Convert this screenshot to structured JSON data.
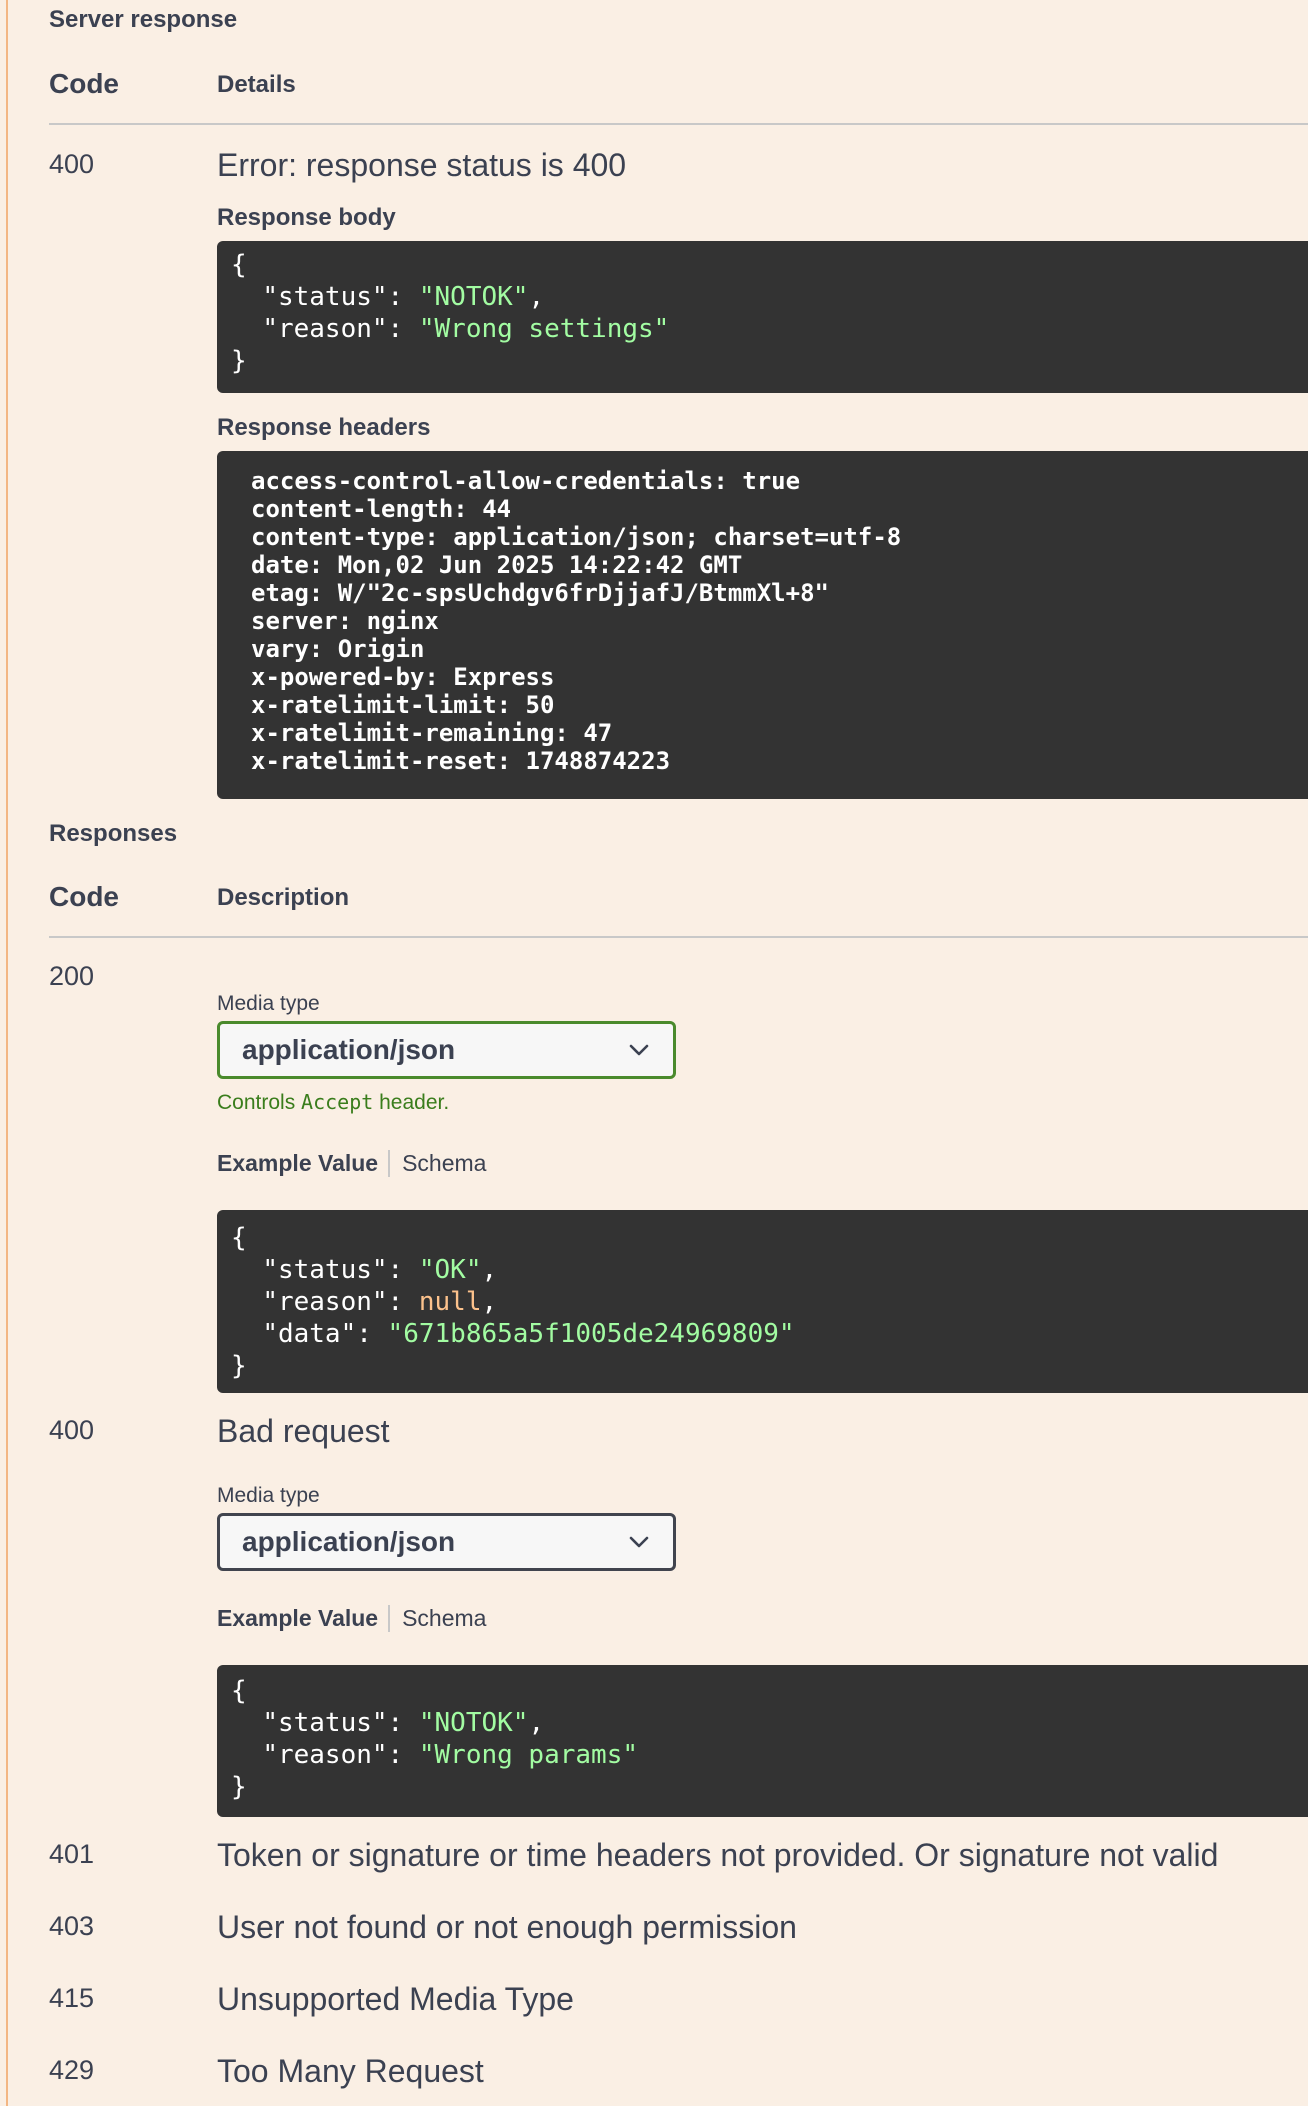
{
  "server_response": {
    "title": "Server response",
    "col_code": "Code",
    "col_details": "Details",
    "code": "400",
    "error_text": "Error: response status is 400",
    "body_label": "Response body",
    "body": {
      "open": "{",
      "line1_key": "\"status\"",
      "line1_val": "\"NOTOK\"",
      "line2_key": "\"reason\"",
      "line2_val": "\"Wrong settings\"",
      "close": "}"
    },
    "headers_label": "Response headers",
    "headers": [
      "access-control-allow-credentials: true",
      "content-length: 44",
      "content-type: application/json; charset=utf-8",
      "date: Mon,02 Jun 2025 14:22:42 GMT",
      "etag: W/\"2c-spsUchdgv6frDjjafJ/BtmmXl+8\"",
      "server: nginx",
      "vary: Origin",
      "x-powered-by: Express",
      "x-ratelimit-limit: 50",
      "x-ratelimit-remaining: 47",
      "x-ratelimit-reset: 1748874223"
    ]
  },
  "responses": {
    "title": "Responses",
    "col_code": "Code",
    "col_description": "Description",
    "r200": {
      "code": "200",
      "media_label": "Media type",
      "media_value": "application/json",
      "hint_prefix": "Controls ",
      "hint_code": "Accept",
      "hint_suffix": " header.",
      "tab_example": "Example Value",
      "tab_schema": "Schema",
      "example": {
        "open": "{",
        "status_key": "\"status\"",
        "status_val": "\"OK\"",
        "reason_key": "\"reason\"",
        "reason_val": "null",
        "data_key": "\"data\"",
        "data_val": "\"671b865a5f1005de24969809\"",
        "close": "}"
      }
    },
    "r400": {
      "code": "400",
      "description": "Bad request",
      "media_label": "Media type",
      "media_value": "application/json",
      "tab_example": "Example Value",
      "tab_schema": "Schema",
      "example": {
        "open": "{",
        "status_key": "\"status\"",
        "status_val": "\"NOTOK\"",
        "reason_key": "\"reason\"",
        "reason_val": "\"Wrong params\"",
        "close": "}"
      }
    },
    "others": [
      {
        "code": "401",
        "description": "Token or signature or time headers not provided. Or signature not valid"
      },
      {
        "code": "403",
        "description": "User not found or not enough permission"
      },
      {
        "code": "415",
        "description": "Unsupported Media Type"
      },
      {
        "code": "429",
        "description": "Too Many Request"
      }
    ]
  },
  "colors": {
    "background": "#faefe4",
    "left_rule": "#f3b683",
    "code_bg": "#333333",
    "json_string": "#a2fca2",
    "json_null": "#fcc28c",
    "accent_green": "#4a8a2c"
  },
  "icons": [
    "chevron-down-icon"
  ]
}
